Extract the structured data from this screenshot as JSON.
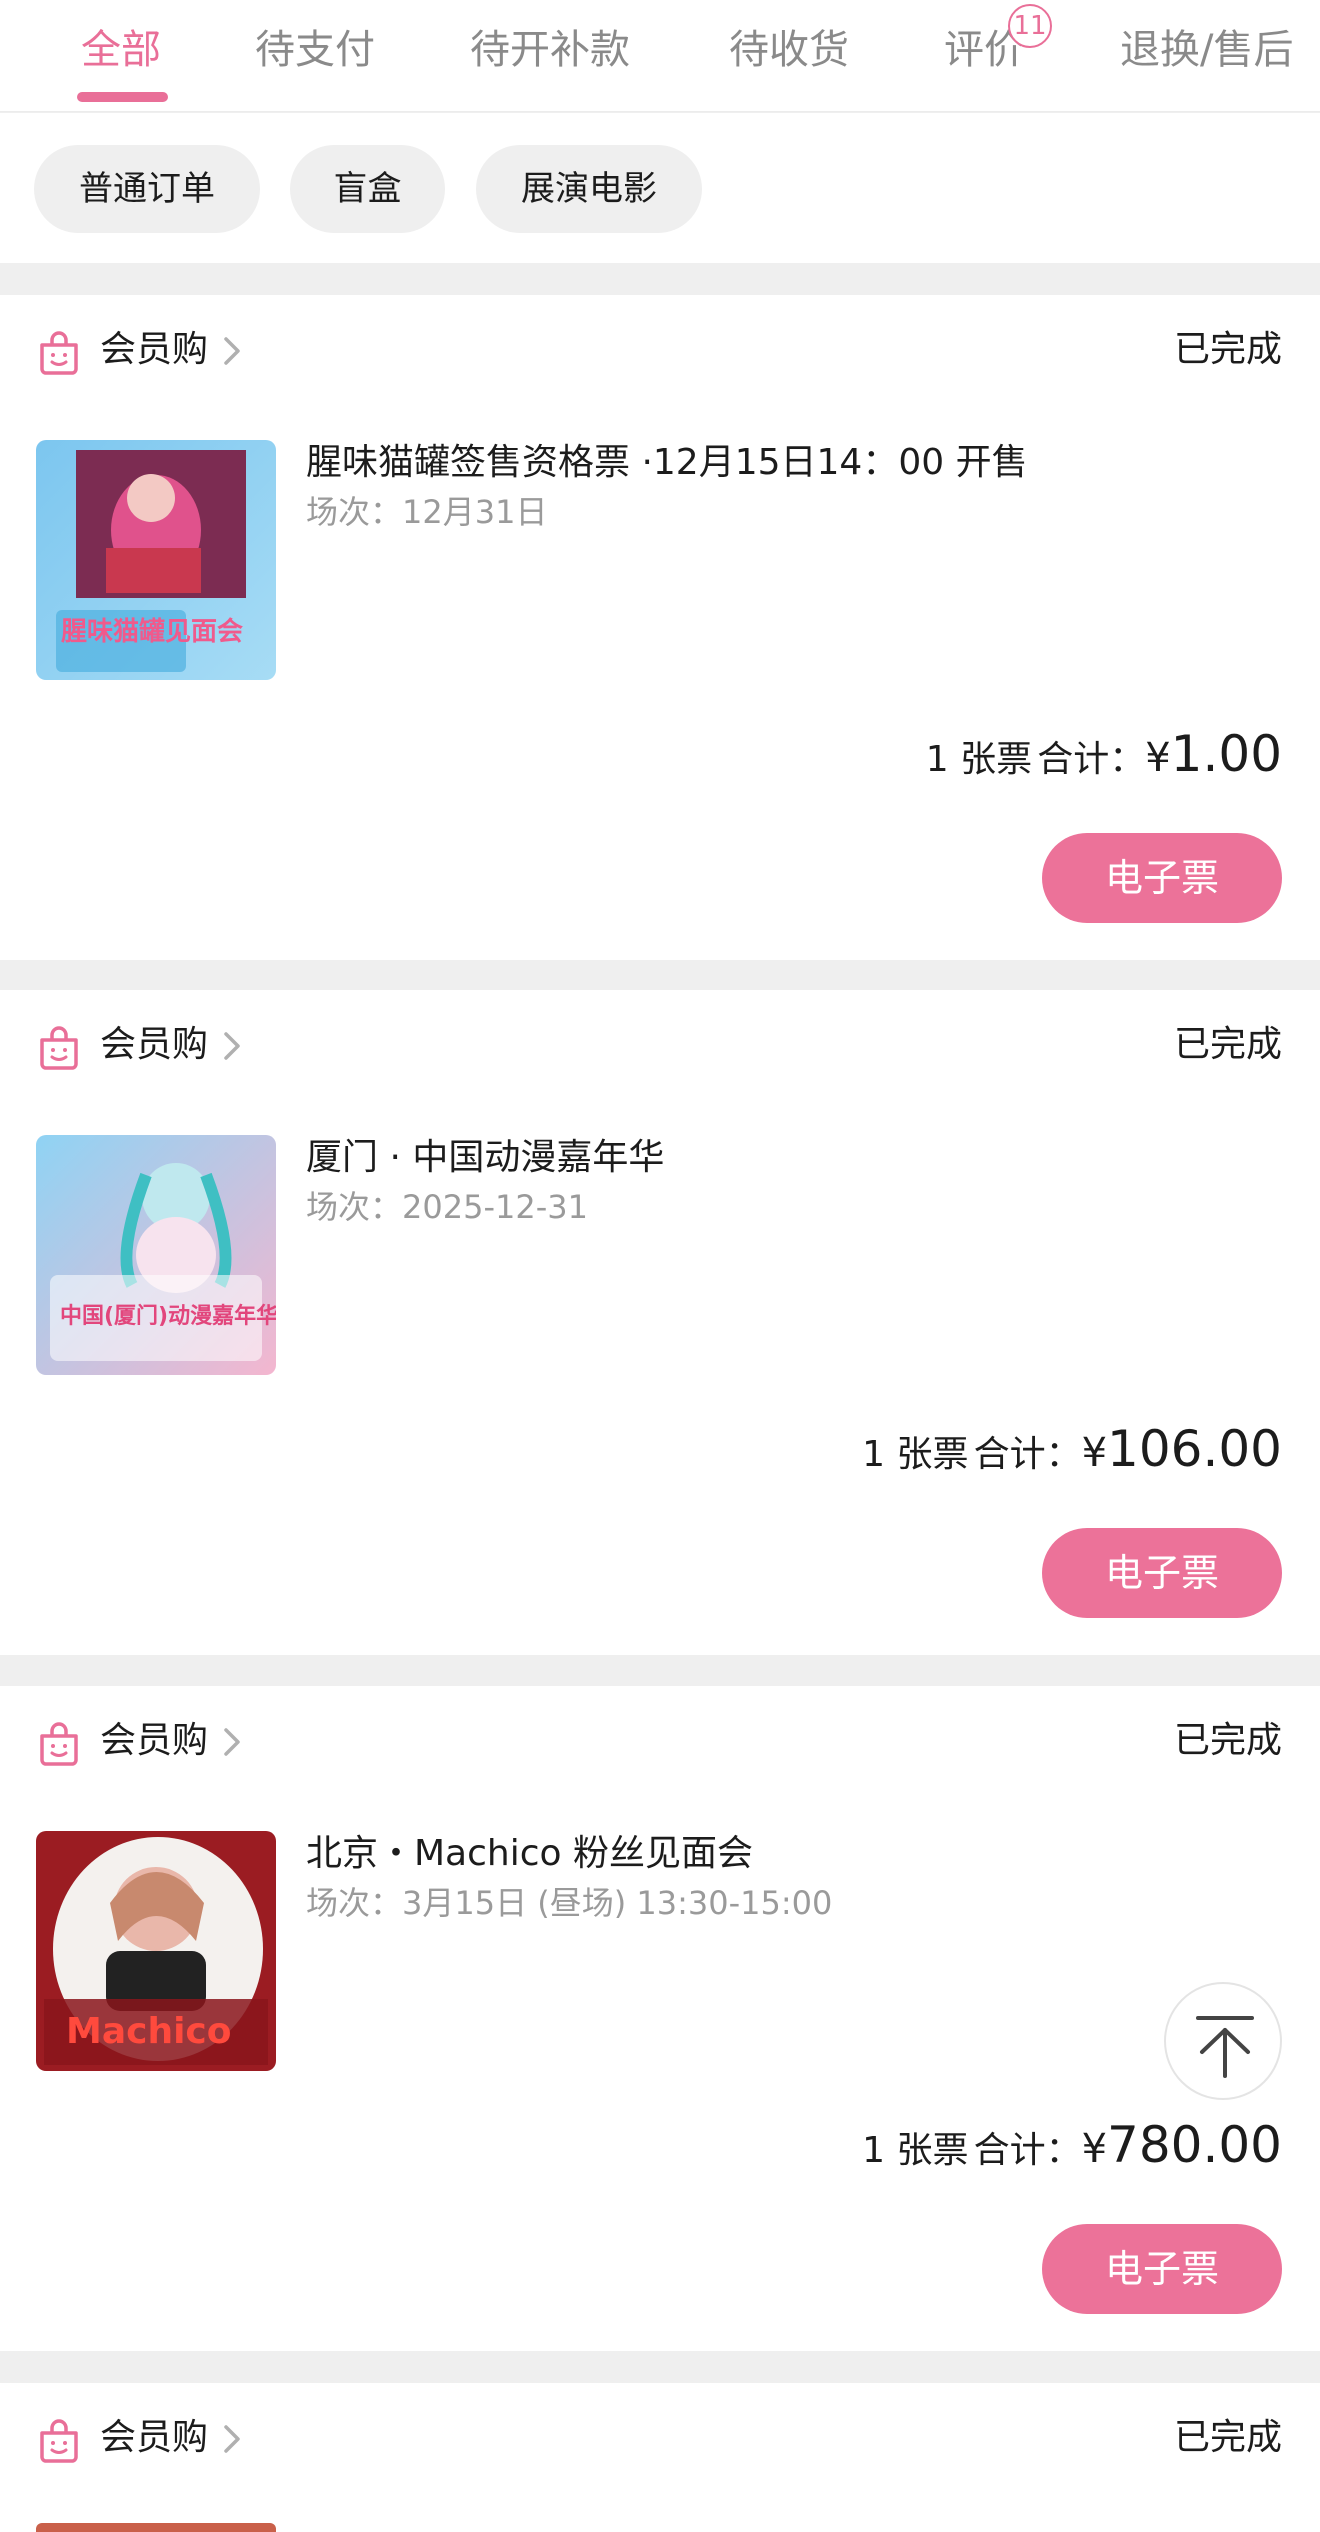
{
  "tabs": [
    {
      "label": "全部",
      "active": true
    },
    {
      "label": "待支付",
      "active": false
    },
    {
      "label": "待开补款",
      "active": false
    },
    {
      "label": "待收货",
      "active": false
    },
    {
      "label": "评价",
      "active": false,
      "badge": "11"
    },
    {
      "label": "退换/售后",
      "active": false
    }
  ],
  "filters": [
    "普通订单",
    "盲盒",
    "展演电影"
  ],
  "orders": [
    {
      "shop": "会员购",
      "status": "已完成",
      "title": "腥味猫罐签售资格票 ·12月15日14：00 开售",
      "session": "场次：12月31日",
      "thumb_text": "腥味猫罐见面会",
      "qty": "1 张票",
      "sum_label": "合计：",
      "currency": "¥",
      "amount": "1.00",
      "button": "电子票"
    },
    {
      "shop": "会员购",
      "status": "已完成",
      "title": "厦门 · 中国动漫嘉年华",
      "session": "场次：2025-12-31",
      "thumb_text": "中国(厦门)动漫嘉年华",
      "qty": "1 张票",
      "sum_label": "合计：",
      "currency": "¥",
      "amount": "106.00",
      "button": "电子票"
    },
    {
      "shop": "会员购",
      "status": "已完成",
      "title": "北京・Machico 粉丝见面会",
      "session": "场次：3月15日 (昼场) 13:30-15:00",
      "thumb_text": "Machico",
      "qty": "1 张票",
      "sum_label": "合计：",
      "currency": "¥",
      "amount": "780.00",
      "button": "电子票"
    },
    {
      "shop": "会员购",
      "status": "已完成"
    }
  ],
  "icons": {
    "shop": "shopping-bag-smile-icon",
    "chevron": "chevron-right-icon",
    "back_to_top": "arrow-up-to-top-icon"
  },
  "colors": {
    "accent": "#e96f98",
    "button": "#ec7299",
    "muted_text": "#9a9a9a",
    "page_bg": "#efefef"
  }
}
